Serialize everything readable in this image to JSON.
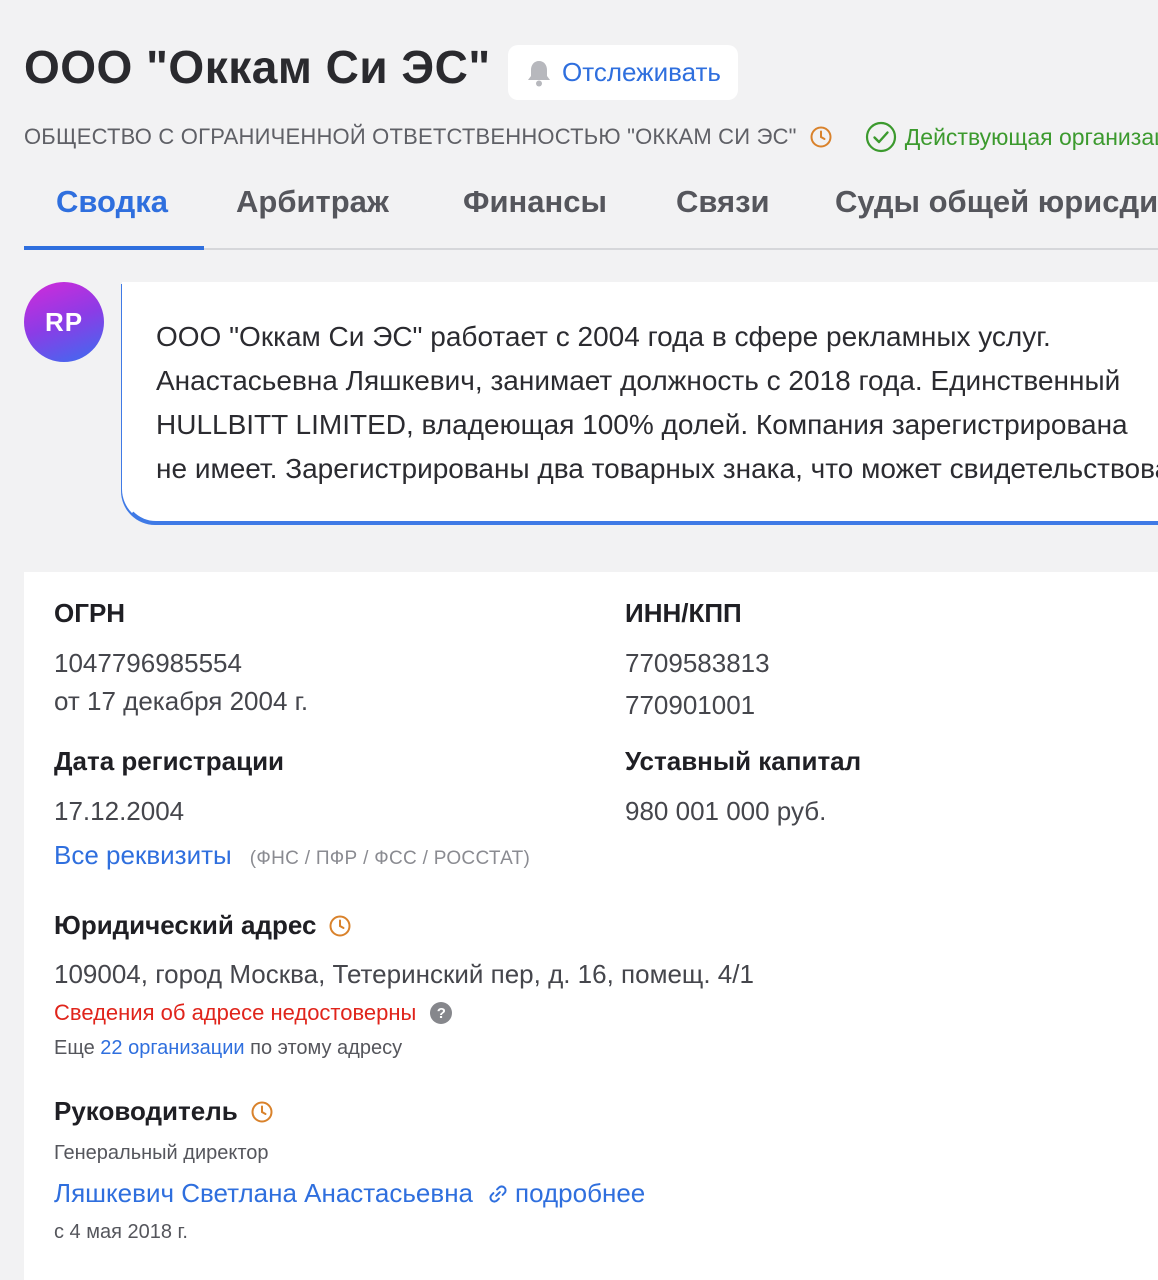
{
  "header": {
    "title": "ООО \"Оккам Си ЭС\"",
    "follow_label": "Отслеживать",
    "full_name": "ОБЩЕСТВО С ОГРАНИЧЕННОЙ ОТВЕТСТВЕННОСТЬЮ \"ОККАМ СИ ЭС\"",
    "status": "Действующая организация"
  },
  "tabs": [
    {
      "label": "Сводка",
      "active": true
    },
    {
      "label": "Арбитраж",
      "active": false
    },
    {
      "label": "Финансы",
      "active": false
    },
    {
      "label": "Связи",
      "active": false
    },
    {
      "label": "Суды общей юрисдикции",
      "active": false
    }
  ],
  "summary": {
    "avatar_initials": "RP",
    "lines": [
      "ООО \"Оккам Си ЭС\" работает с 2004 года в сфере рекламных услуг.",
      "Анастасьевна Ляшкевич, занимает должность с 2018 года. Единственный",
      "HULLBITT LIMITED, владеющая 100% долей. Компания зарегистрирована",
      "не имеет. Зарегистрированы два товарных знака, что может свидетельствовать"
    ]
  },
  "requisites": {
    "ogrn_label": "ОГРН",
    "ogrn_value": "1047796985554",
    "ogrn_date": "от 17 декабря 2004 г.",
    "inn_label": "ИНН/КПП",
    "inn_value": "7709583813",
    "kpp_value": "770901001",
    "reg_date_label": "Дата регистрации",
    "reg_date_value": "17.12.2004",
    "capital_label": "Уставный капитал",
    "capital_value": "980 001 000 руб.",
    "all_link": "Все реквизиты",
    "sources": "(ФНС / ПФР / ФСС / РОССТАТ)"
  },
  "address": {
    "label": "Юридический адрес",
    "value": "109004, город Москва, Тетеринский пер, д. 16, помещ. 4/1",
    "warning": "Сведения об адресе недостоверны",
    "more_prefix": "Еще",
    "more_link": "22 организации",
    "more_suffix": "по этому адресу"
  },
  "director": {
    "label": "Руководитель",
    "position": "Генеральный директор",
    "name": "Ляшкевич Светлана Анастасьевна",
    "details_link": "подробнее",
    "since": "с 4 мая 2018 г."
  },
  "colors": {
    "accent": "#2f6fde",
    "status_green": "#3c9a2e",
    "warning_red": "#e0241b",
    "history_orange": "#d9822b"
  }
}
